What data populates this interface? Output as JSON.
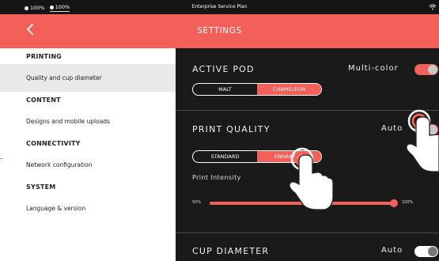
{
  "status": {
    "battery_a": "100%",
    "battery_b": "100%",
    "plan": "Enterprise Service Plan"
  },
  "header": {
    "back_icon": "chevron-left-icon",
    "title": "SETTINGS"
  },
  "sidebar": {
    "sections": [
      {
        "heading": "PRINTING",
        "item": "Quality and cup diameter",
        "active": true
      },
      {
        "heading": "CONTENT",
        "item": "Designs and mobile uploads",
        "active": false
      },
      {
        "heading": "CONNECTIVITY",
        "item": "Network configuration",
        "active": false
      },
      {
        "heading": "SYSTEM",
        "item": "Language & version",
        "active": false
      }
    ]
  },
  "active_pod": {
    "title": "ACTIVE POD",
    "right_label": "Multi-color",
    "toggle_on": true,
    "options": [
      "MALT",
      "CHAMELEON"
    ],
    "selected": "CHAMELEON"
  },
  "print_quality": {
    "title": "PRINT QUALITY",
    "right_label": "Auto",
    "options": [
      "STANDARD",
      "ENHANCED"
    ],
    "selected": "ENHANCED",
    "intensity_label": "Print Intensity",
    "min_label": "50%",
    "max_label": "100%",
    "intensity_value_percent": 100
  },
  "cup_diameter": {
    "title": "CUP DIAMETER",
    "right_label": "Auto",
    "toggle_on": false
  },
  "colors": {
    "accent": "#f26059",
    "panel": "#1a1a1a",
    "statusbar": "#151515"
  }
}
